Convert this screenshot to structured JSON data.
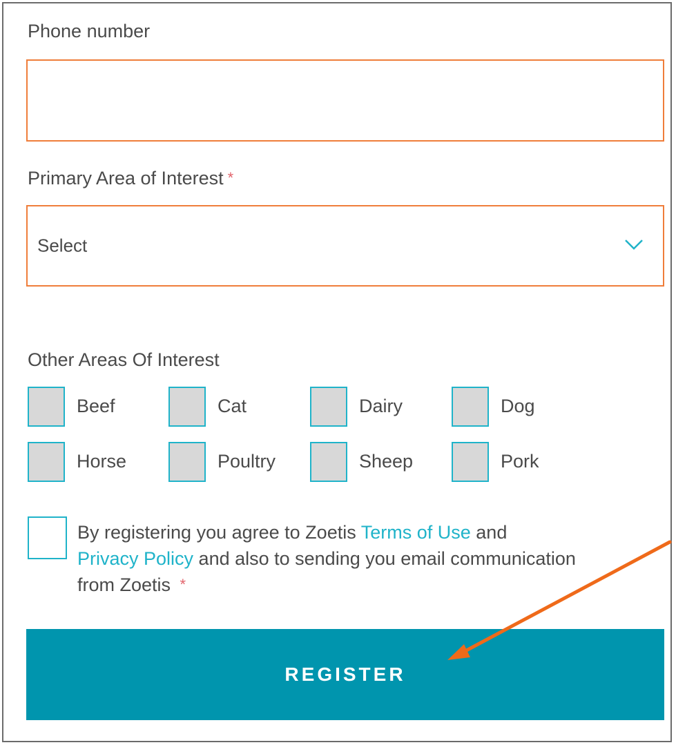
{
  "form": {
    "phone": {
      "label": "Phone number",
      "value": "",
      "placeholder": ""
    },
    "primary_interest": {
      "label": "Primary Area of Interest",
      "required_mark": "*",
      "selected": "Select"
    },
    "other_interests": {
      "label": "Other Areas Of Interest",
      "options": [
        "Beef",
        "Cat",
        "Dairy",
        "Dog",
        "Horse",
        "Poultry",
        "Sheep",
        "Pork"
      ]
    },
    "agreement": {
      "text_1": "By registering you agree to Zoetis ",
      "terms_link": "Terms of Use",
      "text_2": " and",
      "privacy_link": "Privacy Policy",
      "text_3": " and also to sending you email communication from Zoetis ",
      "required_mark": "*"
    },
    "register_label": "REGISTER"
  },
  "colors": {
    "accent": "#0095ae",
    "checkbox_border": "#1fb3c9",
    "field_border": "#ef7d3a",
    "annotation_arrow": "#ef6a1a",
    "required": "#e2636b"
  },
  "icons": {
    "select_arrow": "chevron-down-icon"
  }
}
